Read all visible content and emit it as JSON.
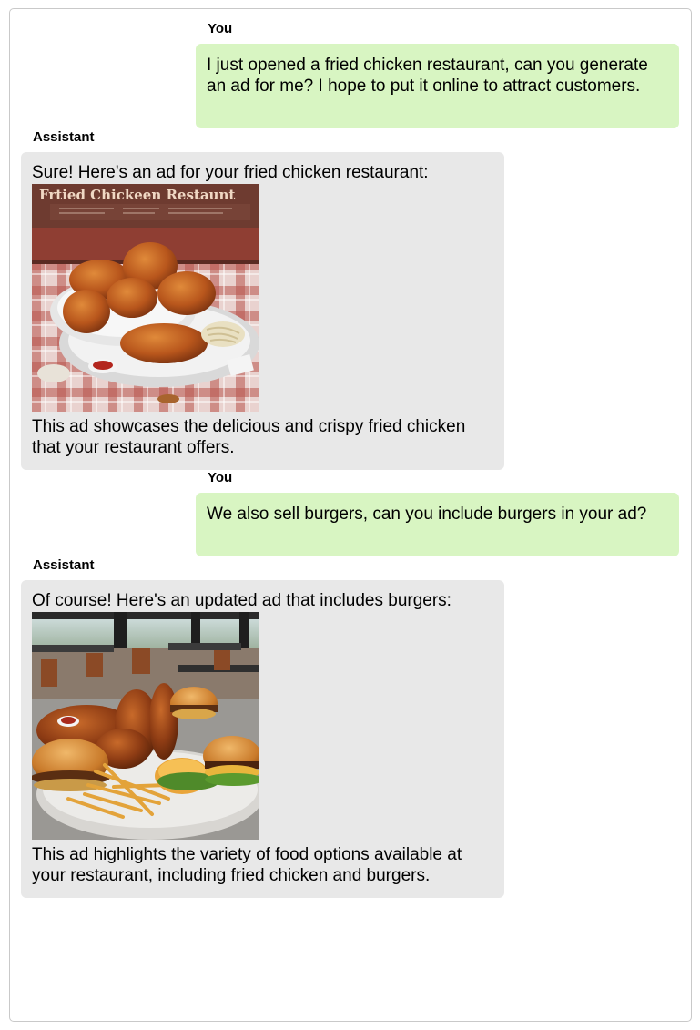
{
  "conversation": {
    "messages": [
      {
        "sender": "You",
        "text": "I just opened a fried chicken restaurant, can you generate an ad for me? I hope to put it online to attract customers."
      },
      {
        "sender": "Assistant",
        "text_before": "Sure! Here's an ad for your fried chicken restaurant:",
        "image_sign_text": "Frtied Chickeen Restaunt",
        "text_after": "This ad showcases the delicious and crispy fried chicken that your restaurant offers."
      },
      {
        "sender": "You",
        "text": "We also sell burgers, can you include burgers in your ad?"
      },
      {
        "sender": "Assistant",
        "text_before": "Of course! Here's an updated ad that includes burgers:",
        "text_after": "This ad highlights the variety of food options available at your restaurant, including fried chicken and burgers."
      }
    ]
  },
  "colors": {
    "user_bubble": "#d8f5c2",
    "assistant_bubble": "#e8e8e8",
    "frame_border": "#c9c9c9"
  }
}
